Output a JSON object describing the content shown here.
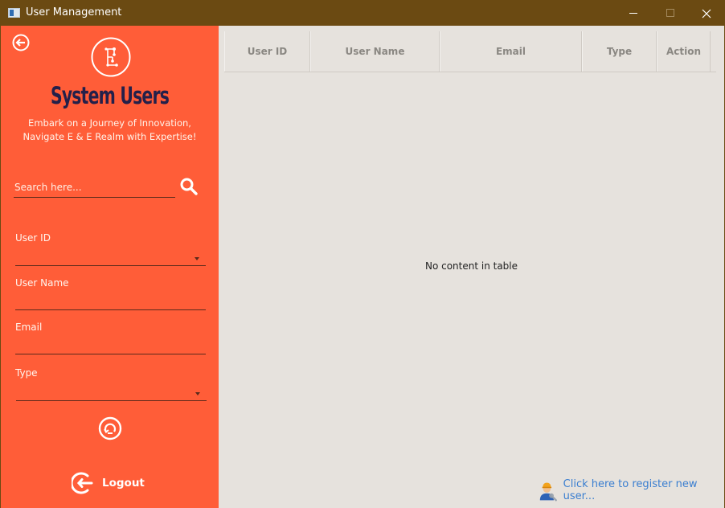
{
  "window": {
    "title": "User Management"
  },
  "sidebar": {
    "heading": "System Users",
    "tagline_line1": "Embark on a Journey of Innovation,",
    "tagline_line2": "Navigate E & E Realm with Expertise!",
    "search": {
      "placeholder": "Search here...",
      "value": ""
    },
    "fields": [
      {
        "label": "User ID",
        "type": "combo",
        "value": ""
      },
      {
        "label": "User Name",
        "type": "text",
        "value": ""
      },
      {
        "label": "Email",
        "type": "text",
        "value": ""
      },
      {
        "label": "Type",
        "type": "combo",
        "value": ""
      }
    ],
    "logout_label": "Logout"
  },
  "table": {
    "columns": [
      "User ID",
      "User Name",
      "Email",
      "Type",
      "Action"
    ],
    "rows": [],
    "empty_message": "No content in table"
  },
  "register_link": "Click here to register new user...",
  "colors": {
    "titlebar": "#6b4a12",
    "sidebar": "#ff5d38",
    "heading": "#24204a",
    "content_bg": "#e6e2dd",
    "link": "#3a7ed0"
  },
  "icons": [
    "app-icon",
    "back-arrow-icon",
    "logo-icon",
    "search-icon",
    "chevron-down-icon",
    "reset-icon",
    "logout-icon",
    "worker-icon"
  ]
}
